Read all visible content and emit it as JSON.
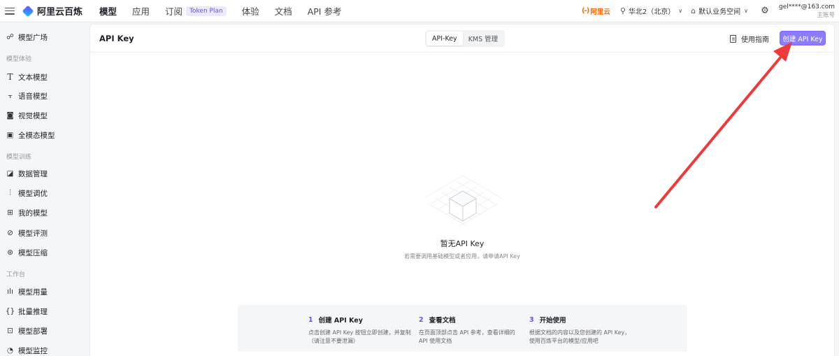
{
  "header": {
    "brand": "阿里云百炼",
    "nav": [
      {
        "label": "模型",
        "active": true
      },
      {
        "label": "应用"
      },
      {
        "label": "订阅",
        "badge": "Token Plan"
      },
      {
        "label": "体验"
      },
      {
        "label": "文档"
      },
      {
        "label": "API 参考"
      }
    ],
    "aliyun_logo": "阿里云",
    "region": "华北2（北京）",
    "workspace": "默认业务空间",
    "user_email": "gel****@163.com",
    "user_role": "主账号"
  },
  "sidebar": {
    "top_item": {
      "label": "模型广场",
      "icon": "model-plaza-icon"
    },
    "sections": [
      {
        "title": "模型体验",
        "items": [
          {
            "label": "文本模型",
            "icon": "text-icon"
          },
          {
            "label": "语音模型",
            "icon": "audio-wave-icon"
          },
          {
            "label": "视觉模型",
            "icon": "camera-icon"
          },
          {
            "label": "全模态模型",
            "icon": "omni-icon"
          }
        ]
      },
      {
        "title": "模型训练",
        "items": [
          {
            "label": "数据管理",
            "icon": "data-chart-icon"
          },
          {
            "label": "模型调优",
            "icon": "sliders-icon"
          },
          {
            "label": "我的模型",
            "icon": "grid-icon"
          },
          {
            "label": "模型评测",
            "icon": "compass-icon"
          },
          {
            "label": "模型压缩",
            "icon": "compress-icon"
          }
        ]
      },
      {
        "title": "工作台",
        "items": [
          {
            "label": "模型用量",
            "icon": "bar-chart-icon"
          },
          {
            "label": "批量推理",
            "icon": "brackets-icon"
          },
          {
            "label": "模型部署",
            "icon": "deploy-icon"
          },
          {
            "label": "模型监控",
            "icon": "pie-icon"
          }
        ]
      }
    ]
  },
  "main": {
    "title": "API Key",
    "tabs": [
      {
        "label": "API-Key",
        "active": true
      },
      {
        "label": "KMS 管理"
      }
    ],
    "guide_label": "使用指南",
    "create_label": "创建 API Key",
    "empty_title": "暂无API Key",
    "empty_desc": "若需要调用基础模型或者应用，请申请API Key",
    "steps": [
      {
        "num": "1",
        "title": "创建 API Key",
        "desc": "点击创建 API Key 按钮立即创建，并复制（请注意不要泄漏）"
      },
      {
        "num": "2",
        "title": "查看文档",
        "desc": "在页面顶部点击 API 参考，查看详细的 API 使用文档"
      },
      {
        "num": "3",
        "title": "开始使用",
        "desc": "根据文档的内容以及您创建的 API Key，使用百炼平台的模型/应用吧"
      }
    ]
  },
  "colors": {
    "accent": "#8b7cff",
    "step_number": "#5b55f0",
    "arrow": "#f03a3a",
    "aliyun_orange": "#ff6a00"
  }
}
